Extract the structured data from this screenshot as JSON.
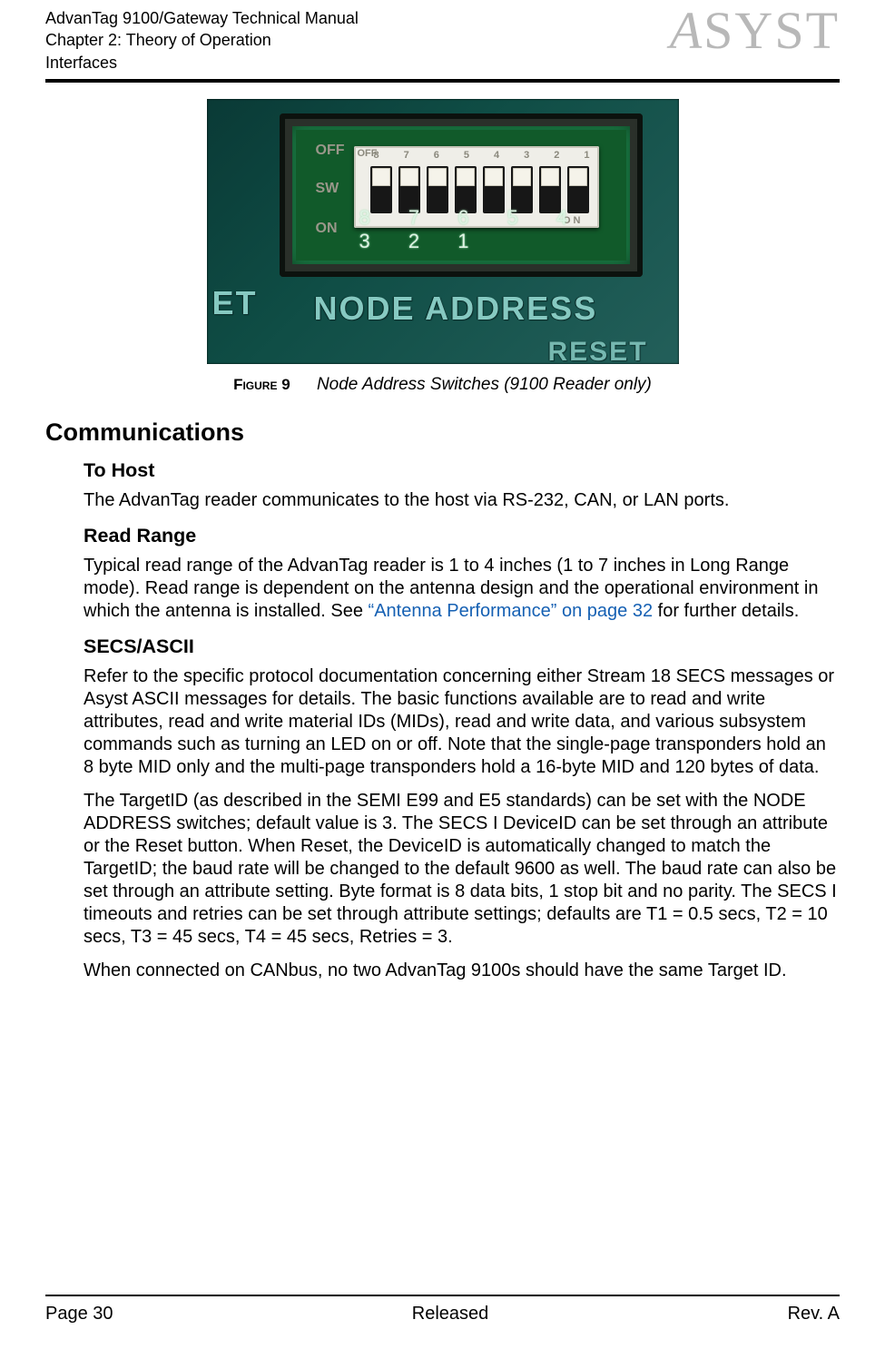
{
  "header": {
    "line1": "AdvanTag 9100/Gateway Technical Manual",
    "line2": "Chapter 2: Theory of Operation",
    "line3": "Interfaces",
    "logo_text": "ASYST"
  },
  "figure": {
    "number_label": "Figure 9",
    "caption": "Node Address Switches (9100 Reader only)",
    "photo": {
      "panel_text_left": "ET",
      "panel_text_main": "NODE ADDRESS",
      "panel_text_bottom": "RESET",
      "pcb_numbers": "8 7 6 5 4 3 2 1",
      "dip_numbers": [
        "1",
        "2",
        "3",
        "4",
        "5",
        "6",
        "7",
        "8"
      ],
      "side_off": "OFF",
      "side_sw": "SW",
      "side_on": "ON",
      "dip_off_label": "OFF",
      "dip_on_label": "O N"
    }
  },
  "section_title": "Communications",
  "subs": {
    "to_host": {
      "heading": "To Host",
      "p1": "The AdvanTag reader communicates to the host via RS-232, CAN, or LAN ports."
    },
    "read_range": {
      "heading": "Read Range",
      "p1_a": "Typical read range of the AdvanTag reader is 1 to 4 inches (1 to 7 inches in Long Range mode). Read range is dependent on the antenna design and the operational environment in which the antenna is installed. See ",
      "p1_xref": "“Antenna Performance” on page 32",
      "p1_b": " for further details."
    },
    "secs": {
      "heading": "SECS/ASCII",
      "p1": "Refer to the specific protocol documentation concerning either Stream 18 SECS messages or Asyst ASCII messages for details. The basic functions available are to read and write attributes, read and write material IDs (MIDs), read and write data, and various subsystem commands such as turning an LED on or off. Note that the single-page transponders hold an 8 byte MID only and the multi-page transponders hold a 16-byte MID and 120 bytes of data.",
      "p2": "The TargetID (as described in the SEMI E99 and E5 standards) can be set with the NODE ADDRESS switches; default value is 3. The SECS I DeviceID can be set through an attribute or the Reset button. When Reset, the DeviceID is automatically changed to match the TargetID; the baud rate will be changed to the default 9600 as well. The baud rate can also be set through an attribute setting. Byte format is 8 data bits, 1 stop bit and no parity. The SECS I timeouts and retries can be set through attribute settings; defaults are T1 = 0.5 secs, T2 = 10 secs, T3 = 45 secs, T4 = 45 secs, Retries = 3.",
      "p3": "When connected on CANbus, no two AdvanTag 9100s should have the same Target ID."
    }
  },
  "footer": {
    "left": "Page 30",
    "center": "Released",
    "right": "Rev. A"
  }
}
